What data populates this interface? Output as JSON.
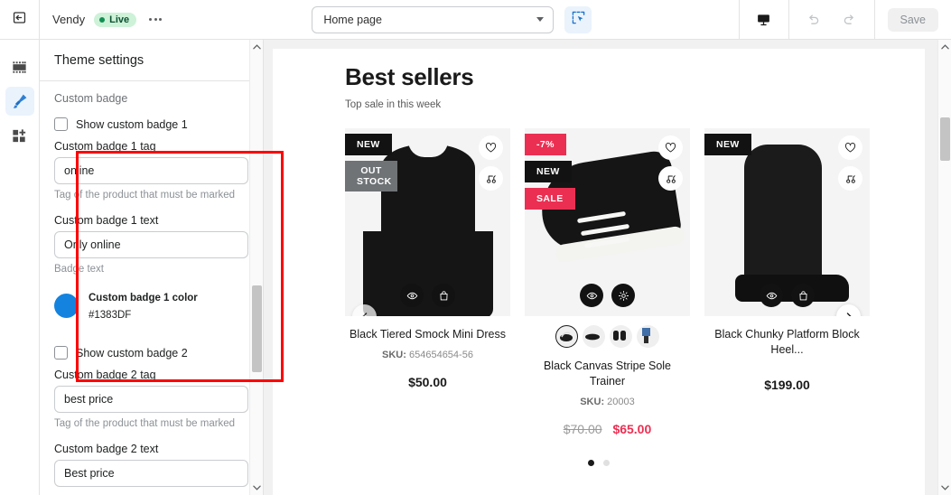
{
  "topbar": {
    "shop_name": "Vendy",
    "live_label": "Live",
    "more_icon": "more-horizontal-icon",
    "exit_icon": "exit-icon",
    "page_selector_value": "Home page",
    "select_tool_icon": "cursor-select-icon",
    "device_icon": "desktop-icon",
    "undo_icon": "undo-icon",
    "redo_icon": "redo-icon",
    "save_label": "Save"
  },
  "rail": {
    "items": [
      {
        "icon": "sections-icon",
        "name": "sections"
      },
      {
        "icon": "paint-brush-icon",
        "name": "theme-settings",
        "active": true
      },
      {
        "icon": "app-blocks-icon",
        "name": "apps"
      }
    ]
  },
  "sidebar": {
    "title": "Theme settings",
    "group_label": "Custom badge",
    "badge1": {
      "show_label": "Show custom badge 1",
      "tag_label": "Custom badge 1 tag",
      "tag_value": "online",
      "tag_help": "Tag of the product that must be marked",
      "text_label": "Custom badge 1 text",
      "text_value": "Only online",
      "text_help": "Badge text",
      "color_label": "Custom badge 1 color",
      "color_hex": "#1383DF"
    },
    "badge2": {
      "show_label": "Show custom badge 2",
      "tag_label": "Custom badge 2 tag",
      "tag_value": "best price",
      "tag_help": "Tag of the product that must be marked",
      "text_label": "Custom badge 2 text",
      "text_value": "Best price"
    },
    "highlight_color": "#ff0000"
  },
  "preview": {
    "section_title": "Best sellers",
    "section_subtitle": "Top sale in this week",
    "prev_arrow_icon": "chevron-left-icon",
    "next_arrow_icon": "chevron-right-icon",
    "pagination": {
      "count": 2,
      "active": 0
    },
    "products": [
      {
        "name": "Black Tiered Smock Mini Dress",
        "sku_label": "SKU:",
        "sku": "654654654-56",
        "price": "$50.00",
        "badges": [
          {
            "text": "NEW",
            "style": "black"
          },
          {
            "text": "OUT STOCK",
            "style": "grey"
          }
        ],
        "actions": [
          "eye-icon",
          "bag-icon"
        ]
      },
      {
        "name": "Black Canvas Stripe Sole Trainer",
        "sku_label": "SKU:",
        "sku": "20003",
        "price_old": "$70.00",
        "price_new": "$65.00",
        "badges": [
          {
            "text": "-7%",
            "style": "pink"
          },
          {
            "text": "NEW",
            "style": "black"
          },
          {
            "text": "SALE",
            "style": "pink"
          }
        ],
        "actions": [
          "eye-icon",
          "gear-icon"
        ],
        "variant_count": 4
      },
      {
        "name": "Black Chunky Platform Block Heel...",
        "price": "$199.00",
        "badges": [
          {
            "text": "NEW",
            "style": "black"
          }
        ],
        "actions": [
          "eye-icon",
          "bag-icon"
        ]
      }
    ]
  }
}
